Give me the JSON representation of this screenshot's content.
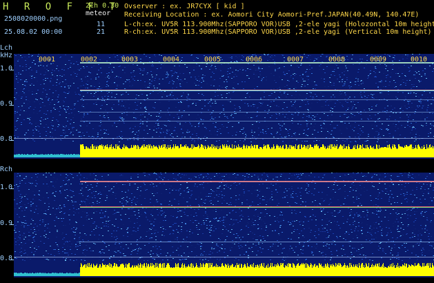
{
  "header": {
    "app_title": "H R O F F T",
    "version": "2ch 0.30",
    "mode": "meteor",
    "filename": "2508020000.png",
    "datetime": "25.08.02 00:00",
    "count_l": "11",
    "count_r": "21",
    "observer": "Ovserver               : ex. JR7CYX [ kid ]",
    "location": "Receiving Location : ex. Aomori City Aomori-Pref.JAPAN(40.49N, 140.47E)",
    "lch_info": "L-ch:ex. UV5R 113.900Mhz(SAPPORO VOR)USB ,2-ele yagi (Holozontal 10m height)",
    "rch_info": "R-ch:ex. UV5R 113.900Mhz(SAPPORO VOR)USB ,2-ele yagi (Vertical 10m height)"
  },
  "lch": {
    "label": "Lch",
    "unit": "kHz",
    "ticks": [
      "1.0",
      "0.9",
      "0.8"
    ]
  },
  "rch": {
    "label": "Rch",
    "ticks": [
      "1.0",
      "0.9",
      "0.8"
    ]
  },
  "time_labels": [
    "0001",
    "0002",
    "0003",
    "0004",
    "0005",
    "0006",
    "0007",
    "0008",
    "0009",
    "0010"
  ],
  "colors": {
    "background": "#000000",
    "waterfall_base": "#0a1a6a",
    "signal_cyan": "#30c0d0",
    "level_yellow": "#ffff00",
    "text_blue": "#9fd0ff",
    "text_yellow": "#ffd84a",
    "title_green": "#c8e85a"
  }
}
